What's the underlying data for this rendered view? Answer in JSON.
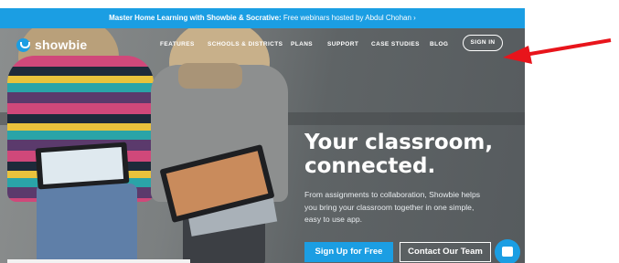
{
  "banner": {
    "bold_text": "Master Home Learning with Showbie & Socrative:",
    "text": " Free webinars hosted by Abdul Chohan",
    "chevron": "›"
  },
  "logo": {
    "text": "showbie",
    "icon": "showbie-logo-icon"
  },
  "nav": {
    "items": [
      {
        "label": "FEATURES"
      },
      {
        "label": "SCHOOLS & DISTRICTS"
      },
      {
        "label": "PLANS"
      },
      {
        "label": "SUPPORT"
      },
      {
        "label": "CASE STUDIES"
      },
      {
        "label": "BLOG"
      }
    ],
    "signin_label": "SIGN IN"
  },
  "hero": {
    "headline_line1": "Your classroom,",
    "headline_line2": "connected.",
    "subcopy": "From assignments to collaboration, Showbie helps you bring your classroom together in one simple, easy to use app.",
    "primary_button": "Sign Up for Free",
    "secondary_button": "Contact Our Team"
  },
  "colors": {
    "accent": "#1b9ee3",
    "annotation_arrow": "#e8141b"
  },
  "chat": {
    "icon": "chat-icon"
  }
}
